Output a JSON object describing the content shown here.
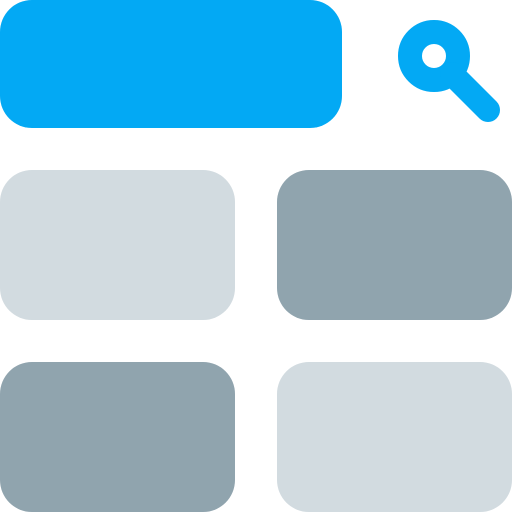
{
  "colors": {
    "accent": "#03a9f4",
    "tile_light": "#d2dbe0",
    "tile_dark": "#90a4ae",
    "background": "#ffffff"
  },
  "search": {
    "icon": "search-icon"
  },
  "tiles": [
    {
      "tone": "tile_light"
    },
    {
      "tone": "tile_dark"
    },
    {
      "tone": "tile_dark"
    },
    {
      "tone": "tile_light"
    }
  ]
}
